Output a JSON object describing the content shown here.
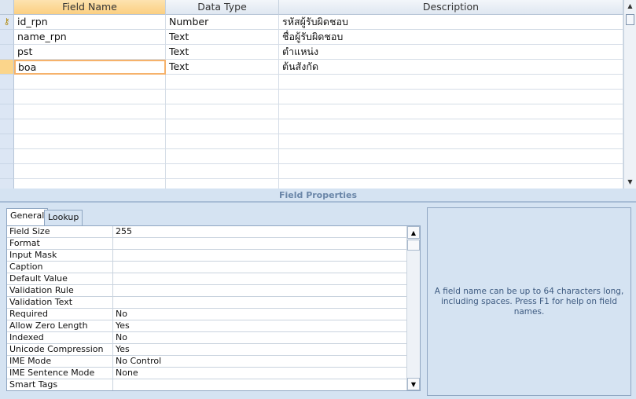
{
  "columns": {
    "field_name": "Field Name",
    "data_type": "Data Type",
    "description": "Description"
  },
  "fields": [
    {
      "name": "id_rpn",
      "type": "Number",
      "desc": "รหัสผู้รับผิดชอบ",
      "primary_key": true
    },
    {
      "name": "name_rpn",
      "type": "Text",
      "desc": "ชื่อผู้รับผิดชอบ"
    },
    {
      "name": "pst",
      "type": "Text",
      "desc": "ตำแหน่ง"
    },
    {
      "name": "boa",
      "type": "Text",
      "desc": "ต้นสังกัด"
    }
  ],
  "field_properties_title": "Field Properties",
  "tabs": [
    "General",
    "Lookup"
  ],
  "properties": [
    {
      "label": "Field Size",
      "value": "255"
    },
    {
      "label": "Format",
      "value": ""
    },
    {
      "label": "Input Mask",
      "value": ""
    },
    {
      "label": "Caption",
      "value": ""
    },
    {
      "label": "Default Value",
      "value": ""
    },
    {
      "label": "Validation Rule",
      "value": ""
    },
    {
      "label": "Validation Text",
      "value": ""
    },
    {
      "label": "Required",
      "value": "No"
    },
    {
      "label": "Allow Zero Length",
      "value": "Yes"
    },
    {
      "label": "Indexed",
      "value": "No"
    },
    {
      "label": "Unicode Compression",
      "value": "Yes"
    },
    {
      "label": "IME Mode",
      "value": "No Control"
    },
    {
      "label": "IME Sentence Mode",
      "value": "None"
    },
    {
      "label": "Smart Tags",
      "value": ""
    }
  ],
  "help_text": "A field name can be up to 64 characters long, including spaces.  Press F1 for help on field names."
}
